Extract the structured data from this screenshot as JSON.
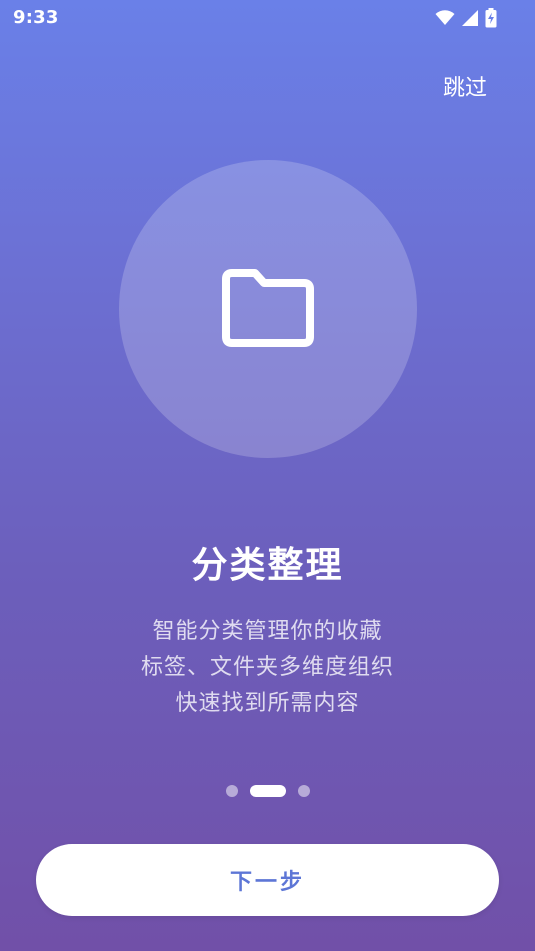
{
  "status_bar": {
    "time": "9:33",
    "icons": [
      "wifi-icon",
      "signal-icon",
      "battery-charging-icon"
    ]
  },
  "skip": {
    "label": "跳过"
  },
  "hero": {
    "icon": "folder-icon"
  },
  "content": {
    "title": "分类整理",
    "description_lines": [
      "智能分类管理你的收藏",
      "标签、文件夹多维度组织",
      "快速找到所需内容"
    ]
  },
  "pager": {
    "total": 3,
    "current": 2
  },
  "next": {
    "label": "下一步"
  },
  "colors": {
    "gradient_top": "#6a80e8",
    "gradient_bottom": "#7150a8",
    "button_text": "#5d76d6"
  }
}
